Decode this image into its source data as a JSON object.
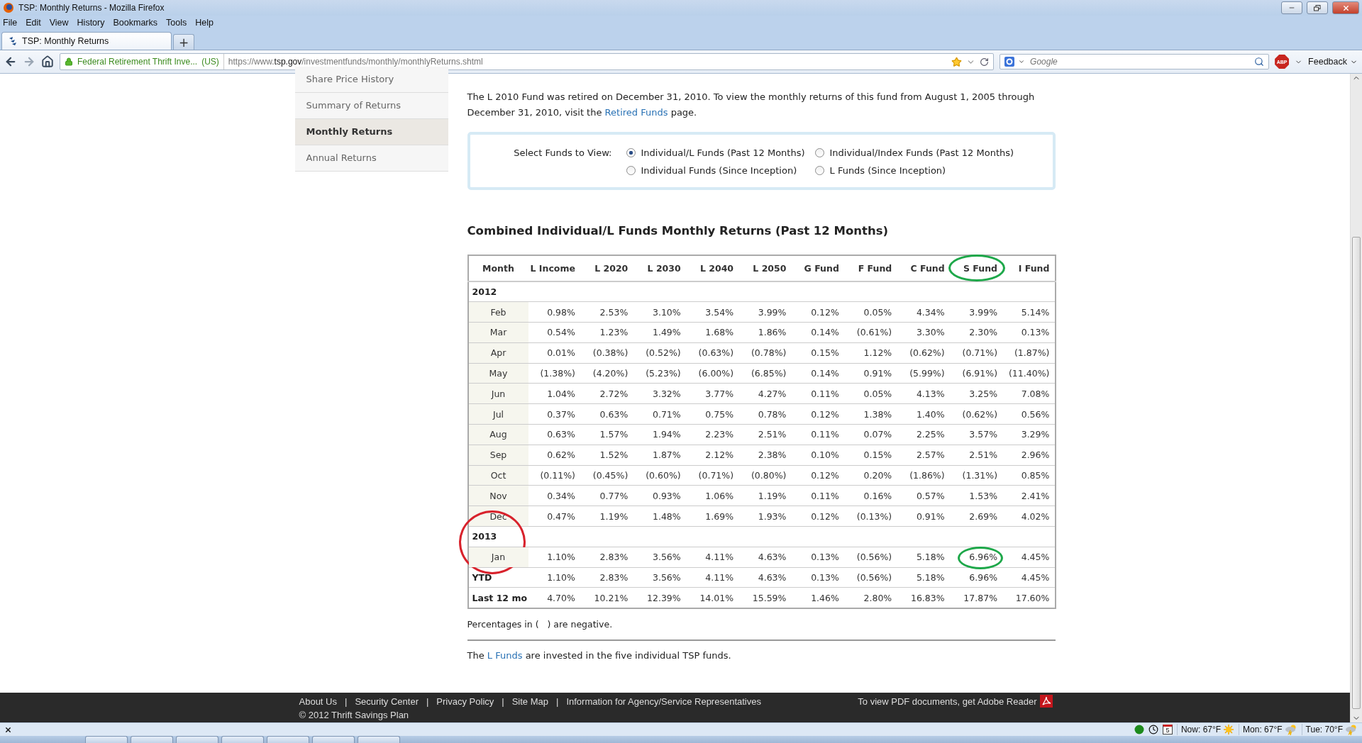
{
  "window": {
    "title": "TSP: Monthly Returns - Mozilla Firefox"
  },
  "menu": [
    "File",
    "Edit",
    "View",
    "History",
    "Bookmarks",
    "Tools",
    "Help"
  ],
  "tab": {
    "label": "TSP: Monthly Returns",
    "new_tab": "+"
  },
  "navbar": {
    "identity": "Federal Retirement Thrift Inve...",
    "identity_country": "(US)",
    "url_prefix": "https://www.",
    "url_host": "tsp.gov",
    "url_path": "/investmentfunds/monthly/monthlyReturns.shtml",
    "search_placeholder": "Google",
    "adblock": "ABP",
    "feedback": "Feedback"
  },
  "sidebar": [
    {
      "label": "Share Price History",
      "selected": false
    },
    {
      "label": "Summary of Returns",
      "selected": false
    },
    {
      "label": "Monthly Returns",
      "selected": true
    },
    {
      "label": "Annual Returns",
      "selected": false
    }
  ],
  "intro": {
    "before": "The L 2010 Fund was retired on December 31, 2010. To view the monthly returns of this fund from August 1, 2005 through December 31, 2010, visit the",
    "link": "Retired Funds",
    "after": "page."
  },
  "selector": {
    "label": "Select Funds to View:",
    "options": [
      {
        "label": "Individual/L Funds (Past 12 Months)",
        "selected": true
      },
      {
        "label": "Individual/Index Funds (Past 12 Months)",
        "selected": false
      },
      {
        "label": "Individual Funds (Since Inception)",
        "selected": false
      },
      {
        "label": "L Funds (Since Inception)",
        "selected": false
      }
    ]
  },
  "table": {
    "title": "Combined Individual/L Funds Monthly Returns (Past 12 Months)",
    "columns": [
      {
        "label": "Month"
      },
      {
        "label": "L Income"
      },
      {
        "label": "L 2020"
      },
      {
        "label": "L 2030"
      },
      {
        "label": "L 2040"
      },
      {
        "label": "L 2050"
      },
      {
        "label": "G Fund"
      },
      {
        "label": "F Fund"
      },
      {
        "label": "C Fund"
      },
      {
        "label": "S Fund",
        "circle": {
          "color": "#1ea84a"
        }
      },
      {
        "label": "I Fund"
      }
    ],
    "sections": [
      {
        "year": "2012",
        "rows": [
          {
            "month": "Feb",
            "values": [
              "0.98%",
              "2.53%",
              "3.10%",
              "3.54%",
              "3.99%",
              "0.12%",
              "0.05%",
              "4.34%",
              "3.99%",
              "5.14%"
            ]
          },
          {
            "month": "Mar",
            "values": [
              "0.54%",
              "1.23%",
              "1.49%",
              "1.68%",
              "1.86%",
              "0.14%",
              "(0.61%)",
              "3.30%",
              "2.30%",
              "0.13%"
            ]
          },
          {
            "month": "Apr",
            "values": [
              "0.01%",
              "(0.38%)",
              "(0.52%)",
              "(0.63%)",
              "(0.78%)",
              "0.15%",
              "1.12%",
              "(0.62%)",
              "(0.71%)",
              "(1.87%)"
            ]
          },
          {
            "month": "May",
            "values": [
              "(1.38%)",
              "(4.20%)",
              "(5.23%)",
              "(6.00%)",
              "(6.85%)",
              "0.14%",
              "0.91%",
              "(5.99%)",
              "(6.91%)",
              "(11.40%)"
            ]
          },
          {
            "month": "Jun",
            "values": [
              "1.04%",
              "2.72%",
              "3.32%",
              "3.77%",
              "4.27%",
              "0.11%",
              "0.05%",
              "4.13%",
              "3.25%",
              "7.08%"
            ]
          },
          {
            "month": "Jul",
            "values": [
              "0.37%",
              "0.63%",
              "0.71%",
              "0.75%",
              "0.78%",
              "0.12%",
              "1.38%",
              "1.40%",
              "(0.62%)",
              "0.56%"
            ]
          },
          {
            "month": "Aug",
            "values": [
              "0.63%",
              "1.57%",
              "1.94%",
              "2.23%",
              "2.51%",
              "0.11%",
              "0.07%",
              "2.25%",
              "3.57%",
              "3.29%"
            ]
          },
          {
            "month": "Sep",
            "values": [
              "0.62%",
              "1.52%",
              "1.87%",
              "2.12%",
              "2.38%",
              "0.10%",
              "0.15%",
              "2.57%",
              "2.51%",
              "2.96%"
            ]
          },
          {
            "month": "Oct",
            "values": [
              "(0.11%)",
              "(0.45%)",
              "(0.60%)",
              "(0.71%)",
              "(0.80%)",
              "0.12%",
              "0.20%",
              "(1.86%)",
              "(1.31%)",
              "0.85%"
            ]
          },
          {
            "month": "Nov",
            "values": [
              "0.34%",
              "0.77%",
              "0.93%",
              "1.06%",
              "1.19%",
              "0.11%",
              "0.16%",
              "0.57%",
              "1.53%",
              "2.41%"
            ]
          },
          {
            "month": "Dec",
            "values": [
              "0.47%",
              "1.19%",
              "1.48%",
              "1.69%",
              "1.93%",
              "0.12%",
              "(0.13%)",
              "0.91%",
              "2.69%",
              "4.02%"
            ]
          }
        ]
      },
      {
        "year": "2013",
        "circle": {
          "color": "#d8222c"
        },
        "rows": [
          {
            "month": "Jan",
            "values": [
              "1.10%",
              "2.83%",
              "3.56%",
              "4.11%",
              "4.63%",
              "0.13%",
              "(0.56%)",
              "5.18%",
              {
                "text": "6.96%",
                "circle": {
                  "color": "#1ea84a"
                }
              },
              "4.45%"
            ]
          }
        ]
      }
    ],
    "summary": [
      {
        "label": "YTD",
        "values": [
          "1.10%",
          "2.83%",
          "3.56%",
          "4.11%",
          "4.63%",
          "0.13%",
          "(0.56%)",
          "5.18%",
          "6.96%",
          "4.45%"
        ]
      },
      {
        "label": "Last 12 mo",
        "values": [
          "4.70%",
          "10.21%",
          "12.39%",
          "14.01%",
          "15.59%",
          "1.46%",
          "2.80%",
          "16.83%",
          "17.87%",
          "17.60%"
        ]
      }
    ]
  },
  "note": "Percentages in (   ) are negative.",
  "lfunds": {
    "before": "The",
    "link": "L Funds",
    "after": "are invested in the five individual TSP funds."
  },
  "footer": {
    "links": [
      "About Us",
      "Security Center",
      "Privacy Policy",
      "Site Map",
      "Information for Agency/Service Representatives"
    ],
    "separator": "|",
    "copyright": "© 2012 Thrift Savings Plan",
    "pdf_note": "To view PDF documents, get Adobe Reader"
  },
  "statusbar": {
    "calendar_day": "5",
    "weather": [
      {
        "label": "Now: 67°F",
        "kind": "sun"
      },
      {
        "label": "Mon: 67°F",
        "kind": "storm"
      },
      {
        "label": "Tue: 70°F",
        "kind": "storm"
      }
    ]
  }
}
